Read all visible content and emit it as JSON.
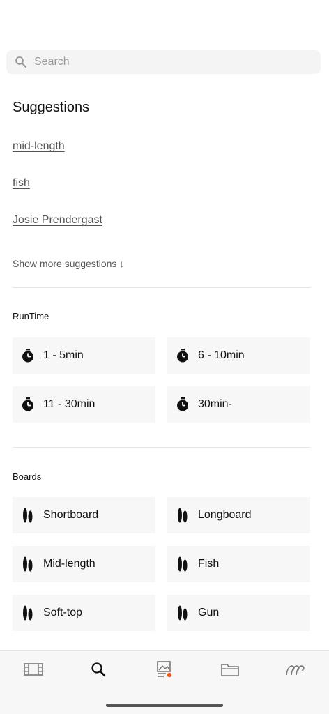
{
  "search": {
    "placeholder": "Search",
    "value": ""
  },
  "suggestions": {
    "title": "Suggestions",
    "items": [
      "mid-length",
      "fish",
      "Josie Prendergast"
    ],
    "show_more": "Show more suggestions ↓"
  },
  "runtime": {
    "label": "RunTime",
    "options": [
      "1 - 5min",
      "6 - 10min",
      "11 - 30min",
      "30min-"
    ]
  },
  "boards": {
    "label": "Boards",
    "options": [
      "Shortboard",
      "Longboard",
      "Mid-length",
      "Fish",
      "Soft-top",
      "Gun"
    ]
  },
  "tabbar": {
    "items": [
      {
        "icon": "film-icon"
      },
      {
        "icon": "search-icon"
      },
      {
        "icon": "feed-icon"
      },
      {
        "icon": "folder-icon"
      },
      {
        "icon": "wave-icon"
      }
    ],
    "accent": "#f05a1a"
  }
}
